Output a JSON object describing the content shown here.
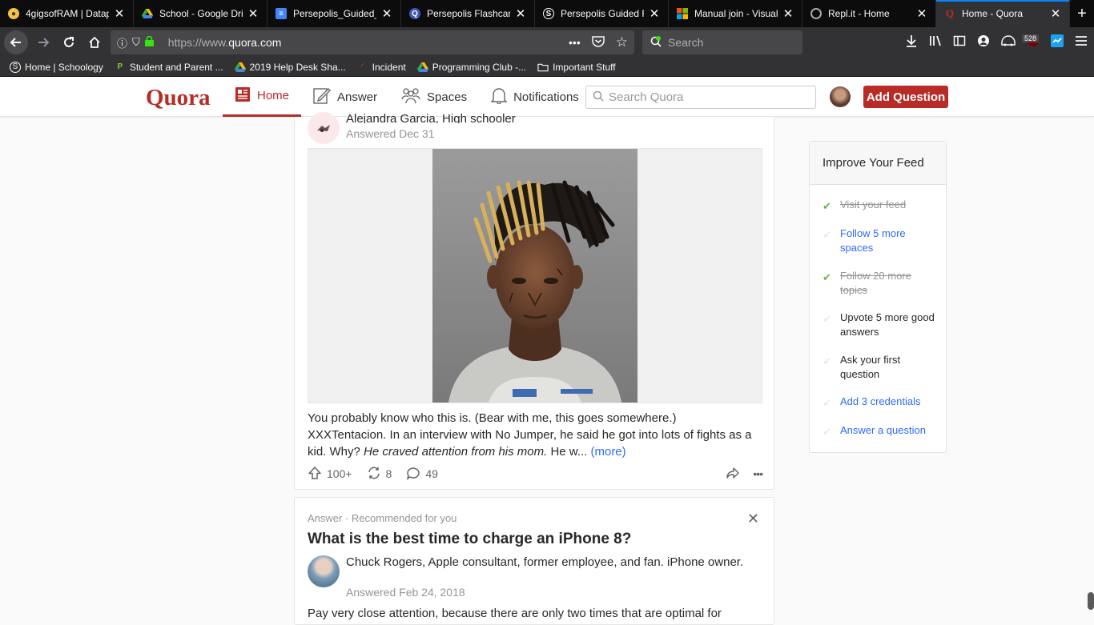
{
  "browser": {
    "tabs": [
      {
        "title": "4gigsofRAM | Datap",
        "favicon": "chrome-owl-icon",
        "active": false
      },
      {
        "title": "School - Google Driv",
        "favicon": "google-drive-icon",
        "active": false
      },
      {
        "title": "Persepolis_Guided_F",
        "favicon": "google-docs-icon",
        "active": false
      },
      {
        "title": "Persepolis Flashcard",
        "favicon": "quizlet-icon",
        "active": false
      },
      {
        "title": "Persepolis Guided R",
        "favicon": "schoology-icon",
        "active": false
      },
      {
        "title": "Manual join - Visual",
        "favicon": "microsoft-icon",
        "active": false
      },
      {
        "title": "Repl.it - Home",
        "favicon": "replit-icon",
        "active": false
      },
      {
        "title": "Home - Quora",
        "favicon": "quora-icon",
        "active": true
      }
    ],
    "url_prefix": "https://www.",
    "url_domain": "quora.com",
    "search_placeholder": "Search",
    "badge_count": "528",
    "bookmarks": [
      {
        "label": "Home | Schoology",
        "icon": "schoology-icon"
      },
      {
        "label": "Student and Parent ...",
        "icon": "p-icon"
      },
      {
        "label": "2019 Help Desk Sha...",
        "icon": "google-drive-icon"
      },
      {
        "label": "Incident",
        "icon": "incident-icon"
      },
      {
        "label": "Programming Club -...",
        "icon": "google-drive-icon"
      },
      {
        "label": "Important Stuff",
        "icon": "folder-icon"
      }
    ]
  },
  "quora": {
    "logo": "Quora",
    "nav": {
      "home": "Home",
      "answer": "Answer",
      "spaces": "Spaces",
      "notifications": "Notifications"
    },
    "search_placeholder": "Search Quora",
    "add_question": "Add Question",
    "accent": "#b92b27"
  },
  "feed": {
    "card1": {
      "author": "Alejandra Garcia, High schooler",
      "answered": "Answered Dec 31",
      "text_1": "You probably know who this is. (Bear with me, this goes somewhere.) XXXTentacion. In an interview with No Jumper, he said he got into lots of fights as a kid. Why? ",
      "text_italic": "He craved attention from his mom.",
      "text_2": " He w... ",
      "more": "(more)",
      "upvotes": "100+",
      "shares": "8",
      "comments": "49"
    },
    "card2": {
      "label": "Answer · Recommended for you",
      "question": "What is the best time to charge an iPhone 8?",
      "author": "Chuck Rogers, Apple consultant, former employee, and fan. iPhone owner.",
      "answered": "Answered Feb 24, 2018",
      "snippet": "Pay very close attention, because there are only two times that are optimal for"
    }
  },
  "sidebar": {
    "title": "Improve Your Feed",
    "steps": [
      {
        "label": "Visit your feed",
        "state": "done"
      },
      {
        "label": "Follow 5 more spaces",
        "state": "link"
      },
      {
        "label": "Follow 20 more topics",
        "state": "done"
      },
      {
        "label": "Upvote 5 more good answers",
        "state": "plain"
      },
      {
        "label": "Ask your first question",
        "state": "plain"
      },
      {
        "label": "Add 3 credentials",
        "state": "link"
      },
      {
        "label": "Answer a question",
        "state": "link"
      }
    ]
  }
}
